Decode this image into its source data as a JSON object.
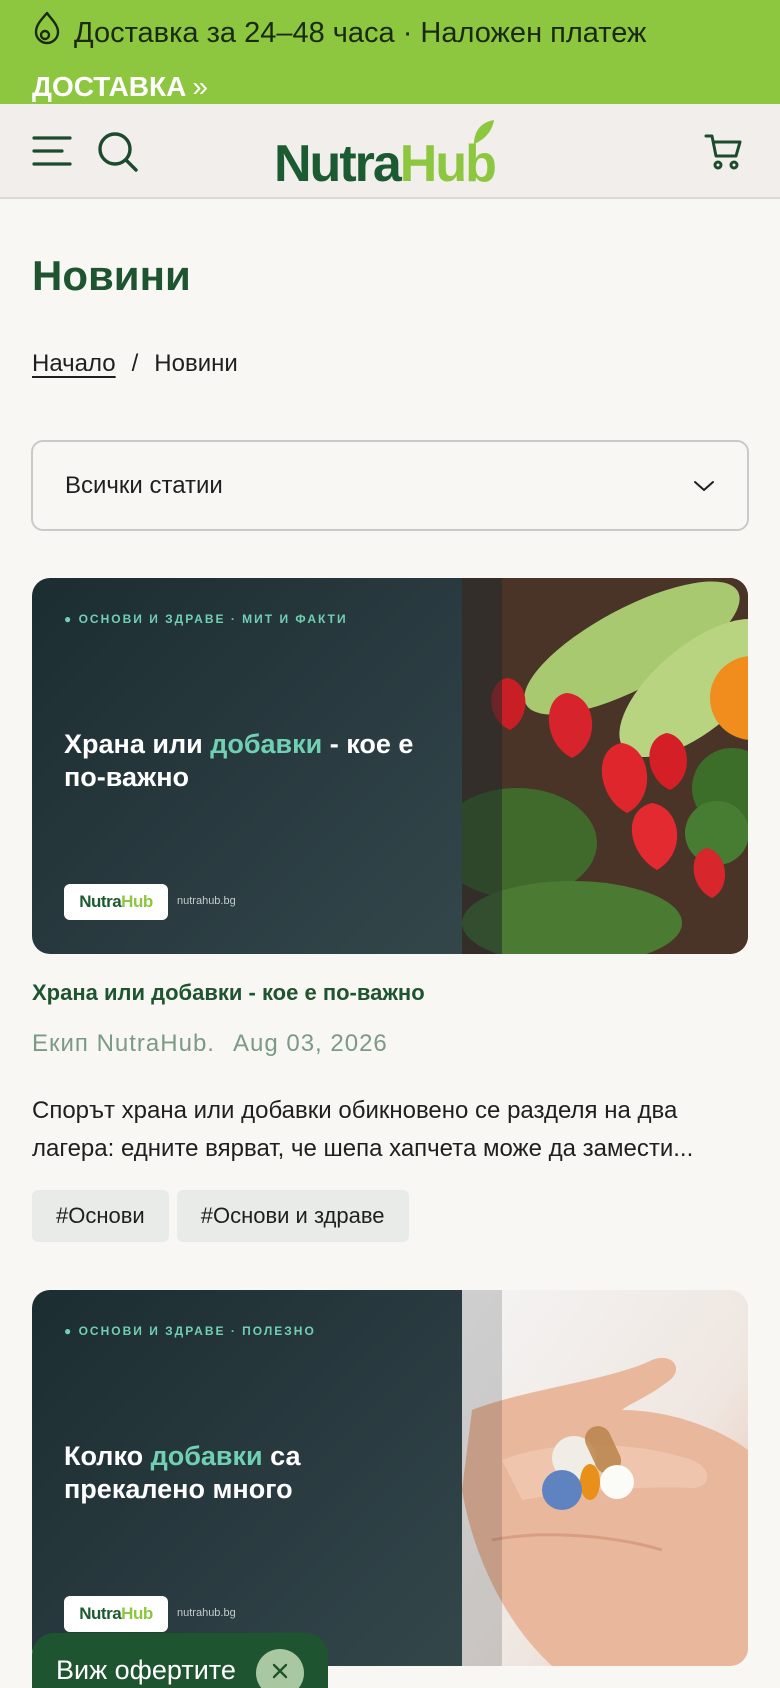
{
  "announcement": {
    "text": "Доставка за 24–48 часа · Наложен платеж",
    "link_label": "ДОСТАВКА",
    "link_chevron": "»"
  },
  "header": {
    "logo_primary": "Nutra",
    "logo_secondary": "Hub",
    "icons": [
      "menu-icon",
      "search-icon",
      "cart-icon"
    ]
  },
  "page": {
    "title": "Новини",
    "breadcrumb": {
      "home": "Начало",
      "separator": "/",
      "current": "Новини"
    }
  },
  "filter": {
    "selected": "Всички статии"
  },
  "posts": [
    {
      "image": {
        "kicker": "● ОСНОВИ И ЗДРАВЕ · МИТ И ФАКТИ",
        "title_before": "Храна или ",
        "title_accent": "добавки",
        "title_after": " - кое е по-важно",
        "badge_primary": "Nutra",
        "badge_secondary": "Hub",
        "site": "nutrahub.bg"
      },
      "title": "Храна или добавки - кое е по-важно",
      "author": "Екип NutraHub.",
      "date": "Aug 03, 2026",
      "excerpt": "Спорът храна или добавки обикновено се разделя на два лагера: едните вярват, че шепа хапчета може да замести...",
      "tags": [
        "#Основи",
        "#Основи и здраве"
      ]
    },
    {
      "image": {
        "kicker": "● ОСНОВИ И ЗДРАВЕ · ПОЛЕЗНО",
        "title_before": "Колко ",
        "title_accent": "добавки",
        "title_after": " са прекалено много",
        "badge_primary": "Nutra",
        "badge_secondary": "Hub",
        "site": "nutrahub.bg"
      }
    }
  ],
  "floating": {
    "offers_label": "Виж офертите"
  },
  "colors": {
    "announcement_bg": "#8dc63f",
    "brand_dark": "#1f5430",
    "brand_light": "#8dc63f",
    "accent_teal": "#6fd0b3"
  }
}
